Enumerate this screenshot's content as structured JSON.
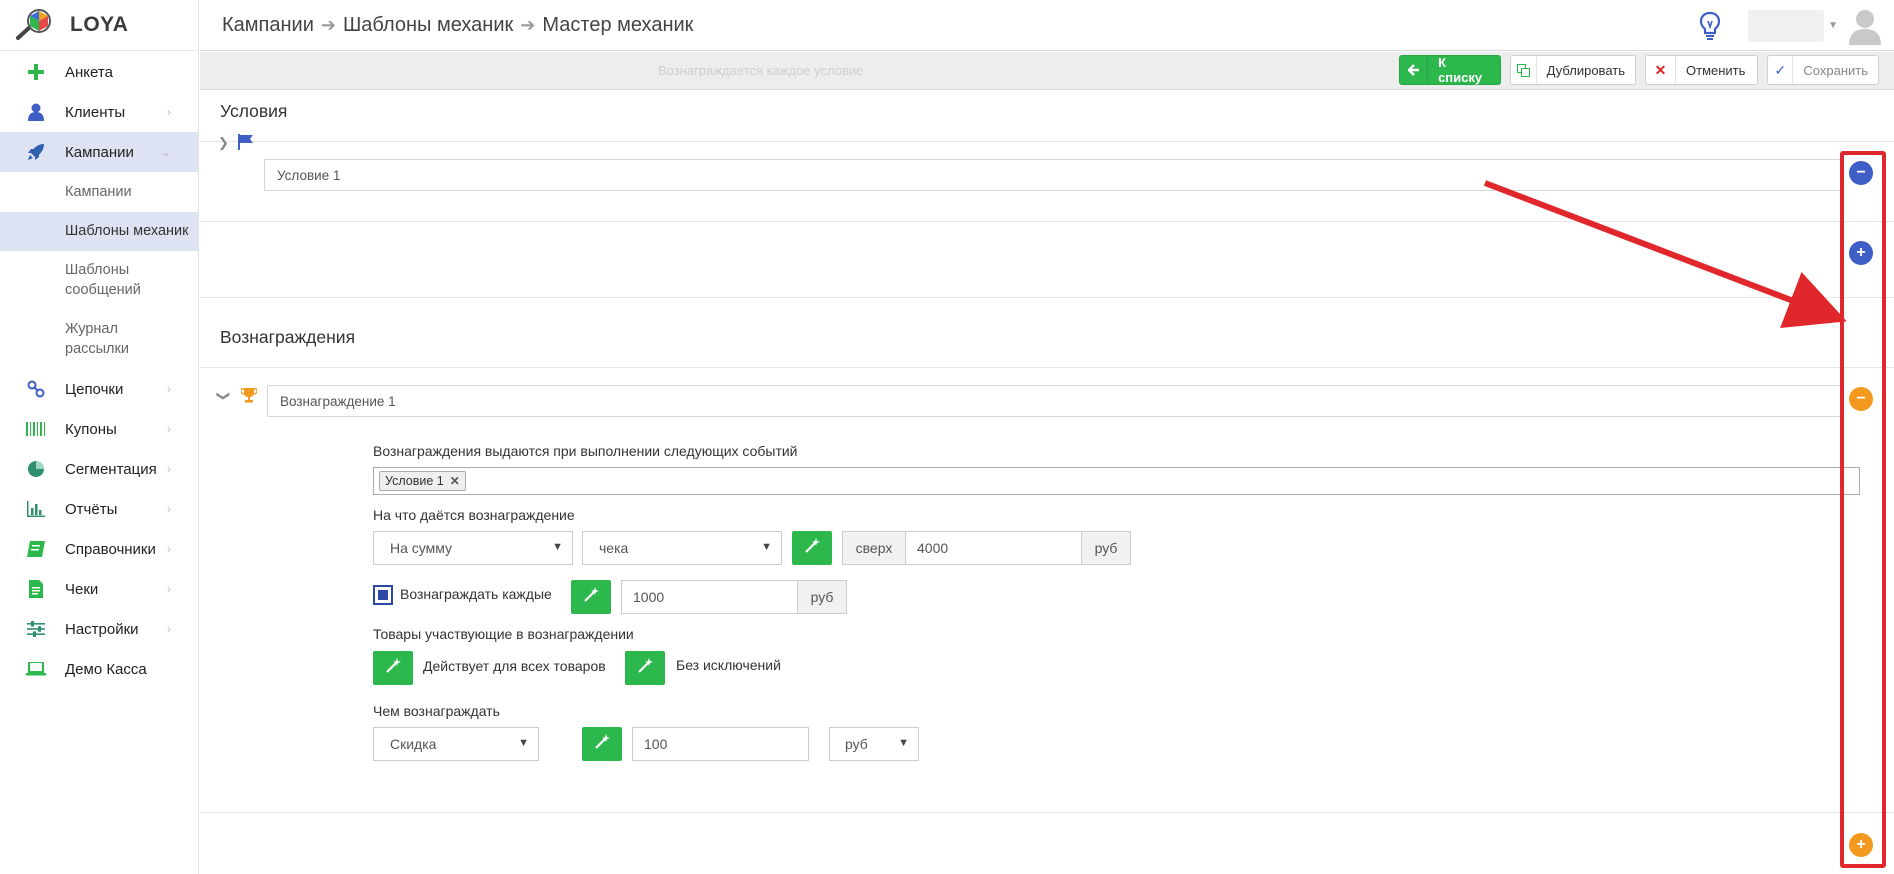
{
  "app": {
    "logo_text": "LOYA"
  },
  "sidebar": {
    "items": [
      {
        "label": "Анкета",
        "icon": "plus-icon",
        "has_chevron": false
      },
      {
        "label": "Клиенты",
        "icon": "user-icon",
        "has_chevron": true
      },
      {
        "label": "Кампании",
        "icon": "rocket-icon",
        "has_chevron": true,
        "expanded": true
      },
      {
        "label": "Цепочки",
        "icon": "chain-icon",
        "has_chevron": true
      },
      {
        "label": "Купоны",
        "icon": "barcode-icon",
        "has_chevron": true
      },
      {
        "label": "Сегментация",
        "icon": "pie-chart-icon",
        "has_chevron": true
      },
      {
        "label": "Отчёты",
        "icon": "bar-chart-icon",
        "has_chevron": true
      },
      {
        "label": "Справочники",
        "icon": "book-icon",
        "has_chevron": true
      },
      {
        "label": "Чеки",
        "icon": "receipt-icon",
        "has_chevron": true
      },
      {
        "label": "Настройки",
        "icon": "sliders-icon",
        "has_chevron": true
      },
      {
        "label": "Демо Касса",
        "icon": "laptop-icon",
        "has_chevron": false
      }
    ],
    "campaign_sub": [
      {
        "label": "Кампании"
      },
      {
        "label": "Шаблоны механик",
        "active": true
      },
      {
        "label": "Шаблоны сообщений"
      },
      {
        "label": "Журнал рассылки"
      }
    ]
  },
  "header": {
    "breadcrumb": [
      "Кампании",
      "Шаблоны механик",
      "Мастер механик"
    ]
  },
  "toolbar": {
    "ghost_text": "Вознаграждается каждое условие",
    "to_list": "К списку",
    "duplicate": "Дублировать",
    "cancel": "Отменить",
    "save": "Сохранить"
  },
  "conditions": {
    "title": "Условия",
    "items": [
      {
        "name": "Условие 1"
      }
    ]
  },
  "rewards": {
    "title": "Вознаграждения",
    "items": [
      {
        "name": "Вознаграждение 1"
      }
    ],
    "events_label": "Вознаграждения выдаются при выполнении следующих событий",
    "event_tags": [
      "Условие 1"
    ],
    "target_label": "На что даётся вознаграждение",
    "target_type": "На сумму",
    "target_object": "чека",
    "over_prefix": "сверх",
    "over_value": "4000",
    "currency": "руб",
    "every_label": "Вознаграждать каждые",
    "every_checked": true,
    "every_value": "1000",
    "products_label": "Товары участвующие в вознаграждении",
    "products_scope": "Действует для всех товаров",
    "products_exceptions": "Без исключений",
    "reward_with_label": "Чем вознаграждать",
    "reward_type": "Скидка",
    "reward_value": "100",
    "reward_unit": "руб"
  },
  "colors": {
    "accent_green": "#2db84d",
    "accent_blue": "#3f5ec6",
    "accent_orange": "#f39a1e",
    "annotation_red": "#e0272b",
    "sidebar_active": "#dde3f3"
  }
}
